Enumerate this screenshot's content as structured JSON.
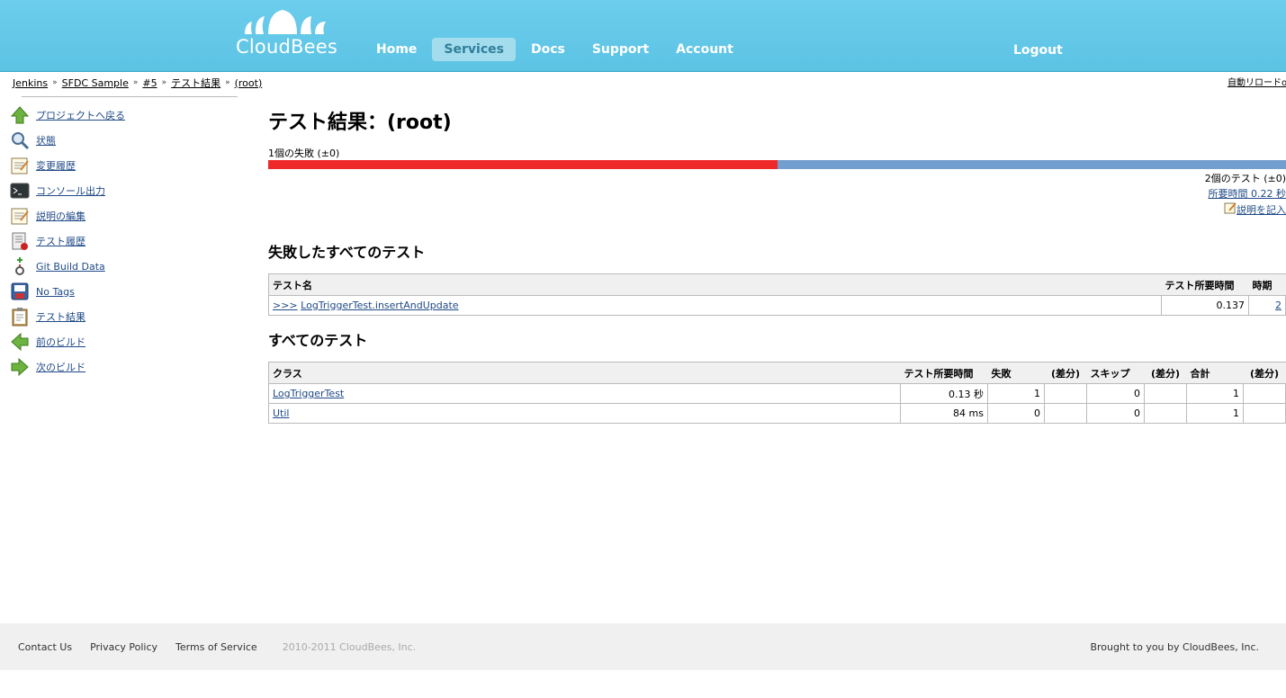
{
  "header": {
    "logo_text": "CloudBees",
    "nav": [
      "Home",
      "Services",
      "Docs",
      "Support",
      "Account"
    ],
    "active_nav": "Services",
    "logout": "Logout"
  },
  "breadcrumb": [
    "Jenkins",
    "SFDC Sample",
    "#5",
    "テスト結果",
    "(root)"
  ],
  "auto_reload": "自動リロードo",
  "sidebar": {
    "items": [
      {
        "label": "プロジェクトへ戻る",
        "icon": "up-arrow-icon"
      },
      {
        "label": "状態",
        "icon": "magnifier-icon"
      },
      {
        "label": "変更履歴",
        "icon": "notepad-icon"
      },
      {
        "label": "コンソール出力",
        "icon": "terminal-icon"
      },
      {
        "label": "説明の編集",
        "icon": "notepad-edit-icon"
      },
      {
        "label": "テスト履歴",
        "icon": "test-history-icon"
      },
      {
        "label": "Git Build Data",
        "icon": "git-icon"
      },
      {
        "label": "No Tags",
        "icon": "save-icon"
      },
      {
        "label": "テスト結果",
        "icon": "clipboard-icon"
      },
      {
        "label": "前のビルド",
        "icon": "left-arrow-icon"
      },
      {
        "label": "次のビルド",
        "icon": "right-arrow-icon"
      }
    ]
  },
  "main": {
    "title": "テスト結果：(root)",
    "fail_count_text": "1個の失敗 (±0)",
    "fail_fraction": 0.5,
    "test_count_text": "2個のテスト (±0)",
    "duration_text": "所要時間 0.22 秒",
    "edit_desc": "説明を記入",
    "failed_heading": "失敗したすべてのテスト",
    "failed_table": {
      "headers": [
        "テスト名",
        "テスト所要時間",
        "時期"
      ],
      "rows": [
        {
          "prefix": ">>>",
          "name": "LogTriggerTest.insertAndUpdate",
          "duration": "0.137",
          "age": "2"
        }
      ]
    },
    "all_heading": "すべてのテスト",
    "all_table": {
      "headers": [
        "クラス",
        "テスト所要時間",
        "失敗",
        "(差分)",
        "スキップ",
        "(差分)",
        "合計",
        "(差分)"
      ],
      "rows": [
        {
          "class": "LogTriggerTest",
          "duration": "0.13 秒",
          "fail": "1",
          "fail_diff": "",
          "skip": "0",
          "skip_diff": "",
          "total": "1",
          "total_diff": ""
        },
        {
          "class": "Util",
          "duration": "84 ms",
          "fail": "0",
          "fail_diff": "",
          "skip": "0",
          "skip_diff": "",
          "total": "1",
          "total_diff": ""
        }
      ]
    }
  },
  "footer": {
    "links": [
      "Contact Us",
      "Privacy Policy",
      "Terms of Service"
    ],
    "copyright": "2010-2011 CloudBees, Inc.",
    "right": "Brought to you by CloudBees, Inc."
  }
}
